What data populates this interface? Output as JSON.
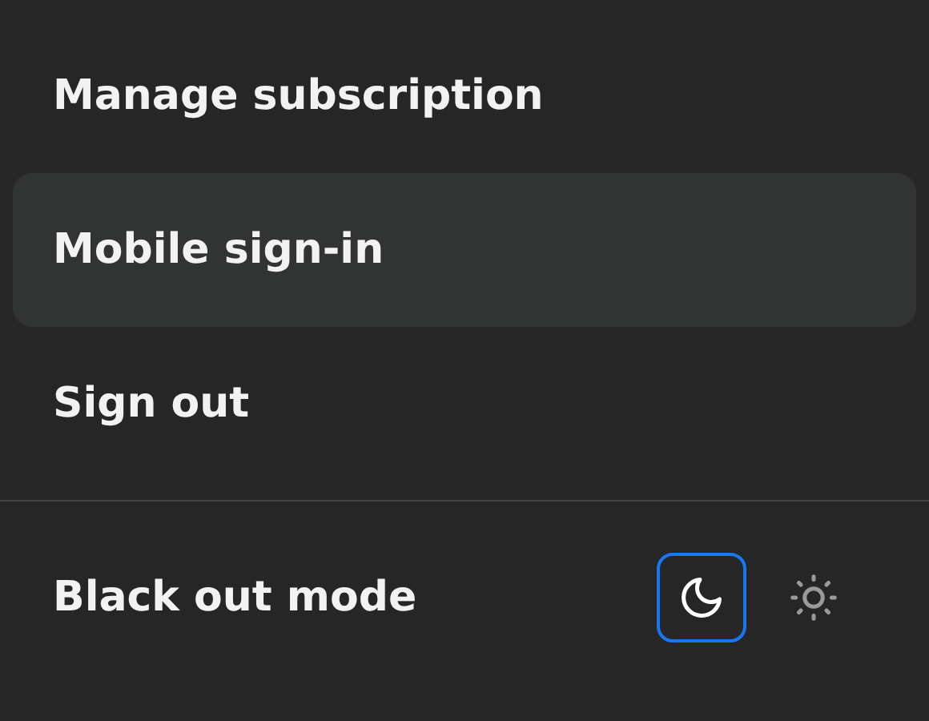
{
  "menu_items": [
    {
      "label": "Manage subscription",
      "selected": false
    },
    {
      "label": "Mobile sign-in",
      "selected": true
    },
    {
      "label": "Sign out",
      "selected": false
    }
  ],
  "theme_row": {
    "label": "Black out mode",
    "options": [
      {
        "kind": "moon",
        "selected": true
      },
      {
        "kind": "sun",
        "selected": false
      }
    ]
  }
}
